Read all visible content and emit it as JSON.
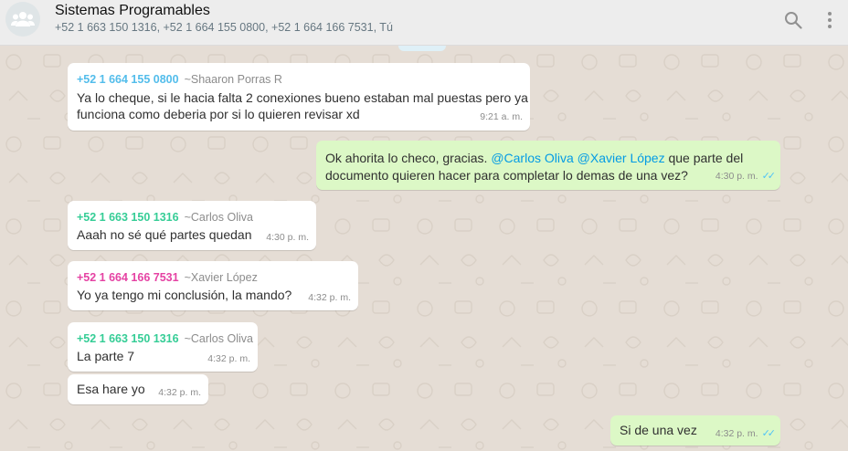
{
  "header": {
    "title": "Sistemas Programables",
    "participants": "+52 1 663 150 1316, +52 1 664 155 0800, +52 1 664 166 7531, Tú",
    "avatar_icon": "group-icon",
    "search_icon": "search-icon",
    "menu_icon": "more-vertical-icon"
  },
  "colors": {
    "chat_background": "#e5ddd5",
    "incoming_bubble": "#ffffff",
    "outgoing_bubble": "#dcf8c6",
    "mention": "#039be5",
    "read_ticks": "#4fc3f7",
    "sender_green": "#35cd96",
    "sender_blue": "#53bdeb",
    "sender_pink": "#e542a3"
  },
  "messages": [
    {
      "direction": "in",
      "sender_number": "+52 1 664 155 0800",
      "sender_alias": "~Shaaron Porras R",
      "line1": "Ya lo cheque, si le hacia falta 2 conexiones bueno estaban mal puestas pero ya",
      "line2": "funciona como deberia por si lo quieren revisar xd",
      "time": "9:21 a. m."
    },
    {
      "direction": "out",
      "line1_pre": "Ok ahorita lo checo, gracias. ",
      "mention1": "@Carlos Oliva",
      "mention2": "@Xavier López",
      "line1_post": " que parte del",
      "line2": "documento quieren hacer para completar lo demas de una vez?",
      "time": "4:30 p. m.",
      "status": "read"
    },
    {
      "direction": "in",
      "sender_number": "+52 1 663 150 1316",
      "sender_alias": "~Carlos Oliva",
      "text": "Aaah no sé qué partes quedan",
      "time": "4:30 p. m."
    },
    {
      "direction": "in",
      "sender_number": "+52 1 664 166 7531",
      "sender_alias": "~Xavier López",
      "text": "Yo ya tengo mi conclusión, la mando?",
      "time": "4:32 p. m."
    },
    {
      "direction": "in",
      "sender_number": "+52 1 663 150 1316",
      "sender_alias": "~Carlos Oliva",
      "text": "La parte 7",
      "time": "4:32 p. m."
    },
    {
      "direction": "in",
      "text": "Esa hare yo",
      "time": "4:32 p. m."
    },
    {
      "direction": "out",
      "text": "Si de una vez",
      "time": "4:32 p. m.",
      "status": "read"
    }
  ]
}
